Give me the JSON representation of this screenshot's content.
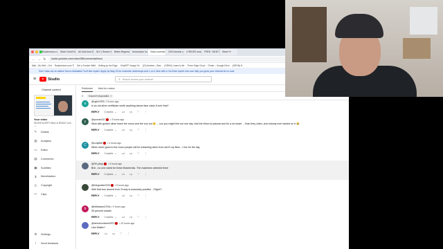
{
  "browser": {
    "traffic_colors": [
      "#ff5f57",
      "#febc2e",
      "#28c840"
    ],
    "tabs": [
      {
        "label": "Roadmmoru.r.com"
      },
      {
        "label": "Silver Gold Enter"
      },
      {
        "label": "All Gold And Sil"
      },
      {
        "label": "SLV | Shares S"
      },
      {
        "label": "Better Regressio"
      },
      {
        "label": "Immovision Industr"
      },
      {
        "label": "Video comment",
        "active": true
      },
      {
        "label": "2023 electric car sales"
      },
      {
        "label": "LYRIDES ressourc"
      },
      {
        "label": "FREE: YAHE Rever"
      },
      {
        "label": "Silver Pr"
      }
    ],
    "url": "studio.youtube.com/video/2Bi/comments/inbox",
    "bookmarks": [
      "Mail – Bo Mell – Out",
      "Roadserioes.com Ti",
      "Get a Trustee Withi",
      "Selling up the Edge",
      "ChatGPT image Ge",
      "(22) Andrew – Bern",
      "(GRHN) I want to Wr",
      "Three Edge Cloud",
      "Finder – Google Drive",
      "(GRHN) N"
    ]
  },
  "banner": {
    "text": "Don't miss out on advice from a dedicated YouTube expert: Apply by May 15 for exclusive workshops and 1-on-1 time with a YouTube expert who can help you grow your channel at no cost."
  },
  "header": {
    "brand": "Studio",
    "search_placeholder": "Search across your channel"
  },
  "sidebar": {
    "title": "Channel content",
    "your_video_label": "Your video",
    "video_title": "SILVER ALERT! Silver Is READY to B...",
    "items": [
      {
        "label": "Details",
        "icon": "pencil-icon",
        "glyph": "✎"
      },
      {
        "label": "Analytics",
        "icon": "analytics-icon",
        "glyph": "▥"
      },
      {
        "label": "Editor",
        "icon": "editor-icon",
        "glyph": "▭"
      },
      {
        "label": "Comments",
        "icon": "comments-icon",
        "glyph": "▤"
      },
      {
        "label": "Subtitles",
        "icon": "subtitles-icon",
        "glyph": "▣"
      },
      {
        "label": "Monetization",
        "icon": "monetization-icon",
        "glyph": "$"
      },
      {
        "label": "Copyright",
        "icon": "copyright-icon",
        "glyph": "©"
      },
      {
        "label": "Clips",
        "icon": "clips-icon",
        "glyph": "✂"
      }
    ],
    "bottom_items": [
      {
        "label": "Settings",
        "icon": "gear-icon",
        "glyph": "⚙"
      },
      {
        "label": "Send feedback",
        "icon": "feedback-icon",
        "glyph": "!"
      }
    ]
  },
  "main": {
    "tabs": [
      {
        "label": "Published",
        "active": true
      },
      {
        "label": "Held for review"
      }
    ],
    "filter_chip": "I haven't responded",
    "reply_label": "REPLY",
    "comments": [
      {
        "handle": "@ogier1933",
        "time": "2 hours ago",
        "text": "Is an old silver certificate worth anything above face value if ever that?",
        "replies": "0 replies",
        "avatar_color": "#1aa39a",
        "initial": "o",
        "member": false
      },
      {
        "handle": "@yunnan317",
        "time": "3 hours ago",
        "text": "Stick with golden silver leave the moon and the sun out 😊 ... cuz you might find out one day, that the Moon is plasma and it's a lot closer ... than they claim, and nobody ever landed on it 😂",
        "replies": "0 replies",
        "avatar_color": "#2e5e4e",
        "initial": "y",
        "member": true
      },
      {
        "handle": "@ccdy666",
        "time": "4 hours ago",
        "text": "When silver goes to the moon people will be extracting silver from old B roy films - I live for the day",
        "replies": "0 replies",
        "avatar_color": "#1a8fa0",
        "initial": "C",
        "member": true
      },
      {
        "handle": "@OK-pikyy",
        "time": "4 hours ago",
        "text": "Brix - no one voted for these Bolsheviks. The machines selected them",
        "replies": "0 replies",
        "avatar_color": "#5a6a80",
        "initial": "",
        "member": true
      },
      {
        "handle": "@livingwater0226",
        "time": "8 hours ago",
        "text": "Well that turn around from Trump is massively positive ...Right?!",
        "replies": "0 replies",
        "avatar_color": "#3a4a3a",
        "initial": "",
        "member": true
      },
      {
        "handle": "@billnbaaus2704c",
        "time": "9 hours ago",
        "text": "35 percent nickels",
        "replies": "0 replies",
        "avatar_color": "#c2185b",
        "initial": "b",
        "member": false
      },
      {
        "handle": "@deredmonimes9970",
        "time": "10 hours ago",
        "text": "Like Walter?",
        "replies": "",
        "avatar_color": "#5c6bc0",
        "initial": "",
        "member": true
      }
    ]
  }
}
